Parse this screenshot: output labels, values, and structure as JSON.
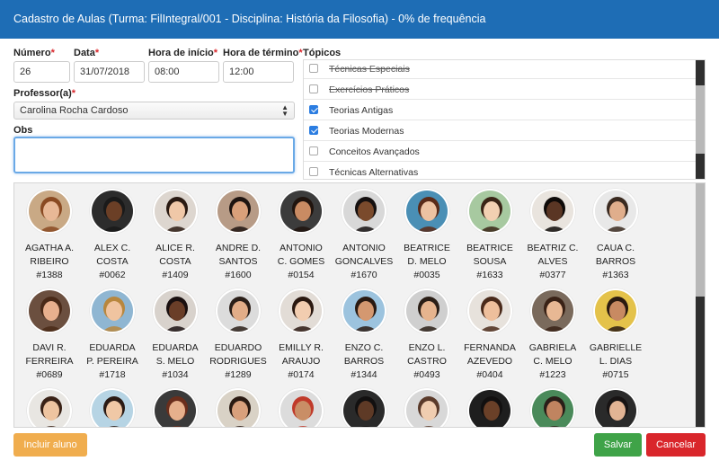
{
  "header": {
    "title": "Cadastro de Aulas (Turma: FilIntegral/001 - Disciplina: História da Filosofia) - 0% de frequência"
  },
  "form": {
    "numero": {
      "label": "Número",
      "value": "26"
    },
    "data": {
      "label": "Data",
      "value": "31/07/2018"
    },
    "hora_inicio": {
      "label": "Hora de início",
      "value": "08:00"
    },
    "hora_termino": {
      "label": "Hora de término",
      "value": "12:00"
    },
    "professor": {
      "label": "Professor(a)",
      "value": "Carolina Rocha Cardoso"
    },
    "obs": {
      "label": "Obs",
      "value": ""
    },
    "required_mark": "*"
  },
  "topics": {
    "label": "Tópicos",
    "items": [
      {
        "label": "Técnicas Especiais",
        "checked": false,
        "struck": true
      },
      {
        "label": "Exercícios Práticos",
        "checked": false,
        "struck": true
      },
      {
        "label": "Teorias Antigas",
        "checked": true,
        "struck": false
      },
      {
        "label": "Teorias Modernas",
        "checked": true,
        "struck": false
      },
      {
        "label": "Conceitos Avançados",
        "checked": false,
        "struck": false
      },
      {
        "label": "Técnicas Alternativas",
        "checked": false,
        "struck": false
      }
    ]
  },
  "students": [
    {
      "first": "AGATHA A.",
      "last": "RIBEIRO",
      "id": "#1388",
      "skin": "#e8b896",
      "hair": "#8a4a22",
      "bg": "#c9a985"
    },
    {
      "first": "ALEX C.",
      "last": "COSTA",
      "id": "#0062",
      "skin": "#6b3f26",
      "hair": "#1a1a1a",
      "bg": "#2c2c2c"
    },
    {
      "first": "ALICE R.",
      "last": "COSTA",
      "id": "#1409",
      "skin": "#f0c8a8",
      "hair": "#2a1a12",
      "bg": "#ddd6cf"
    },
    {
      "first": "ANDRE D.",
      "last": "SANTOS",
      "id": "#1600",
      "skin": "#d9a07a",
      "hair": "#1e1410",
      "bg": "#b79b86"
    },
    {
      "first": "ANTONIO",
      "last": "C. GOMES",
      "id": "#0154",
      "skin": "#c98b63",
      "hair": "#20140e",
      "bg": "#3c3c3c"
    },
    {
      "first": "ANTONIO",
      "last": "GONCALVES",
      "id": "#1670",
      "skin": "#7a4a2c",
      "hair": "#151010",
      "bg": "#d8d8d8"
    },
    {
      "first": "BEATRICE",
      "last": "D. MELO",
      "id": "#0035",
      "skin": "#edc2a2",
      "hair": "#5a2a18",
      "bg": "#4a8fb5"
    },
    {
      "first": "BEATRICE",
      "last": "SOUSA",
      "id": "#1633",
      "skin": "#f2d0b2",
      "hair": "#3a2416",
      "bg": "#a7c9a0"
    },
    {
      "first": "BEATRIZ C.",
      "last": "ALVES",
      "id": "#0377",
      "skin": "#5a3624",
      "hair": "#0e0a08",
      "bg": "#e9e4de"
    },
    {
      "first": "CAUA C.",
      "last": "BARROS",
      "id": "#1363",
      "skin": "#e0ae8c",
      "hair": "#3a2a20",
      "bg": "#e8e8e8"
    },
    {
      "first": "DAVI R.",
      "last": "FERREIRA",
      "id": "#0689",
      "skin": "#e8b08e",
      "hair": "#4a2a18",
      "bg": "#6b4f3f"
    },
    {
      "first": "EDUARDA",
      "last": "P. PEREIRA",
      "id": "#1718",
      "skin": "#f0c4a0",
      "hair": "#b8873e",
      "bg": "#8fb6d2"
    },
    {
      "first": "EDUARDA",
      "last": "S. MELO",
      "id": "#1034",
      "skin": "#6a3e28",
      "hair": "#1a1010",
      "bg": "#d8d2cc"
    },
    {
      "first": "EDUARDO",
      "last": "RODRIGUES",
      "id": "#1289",
      "skin": "#e2ad88",
      "hair": "#2a1e18",
      "bg": "#dcdcdc"
    },
    {
      "first": "EMILLY R.",
      "last": "ARAUJO",
      "id": "#0174",
      "skin": "#f2cdb0",
      "hair": "#2a1810",
      "bg": "#e2dcd6"
    },
    {
      "first": "ENZO C.",
      "last": "BARROS",
      "id": "#1344",
      "skin": "#d49870",
      "hair": "#2a1a12",
      "bg": "#9cc3de"
    },
    {
      "first": "ENZO L.",
      "last": "CASTRO",
      "id": "#0493",
      "skin": "#e6b48e",
      "hair": "#2a1e16",
      "bg": "#cfcfcf"
    },
    {
      "first": "FERNANDA",
      "last": "AZEVEDO",
      "id": "#0404",
      "skin": "#eebf9c",
      "hair": "#4a2a1a",
      "bg": "#e7e2dc"
    },
    {
      "first": "GABRIELA",
      "last": "C. MELO",
      "id": "#1223",
      "skin": "#e8b894",
      "hair": "#3a2216",
      "bg": "#7a6a5c"
    },
    {
      "first": "GABRIELLE",
      "last": "L. DIAS",
      "id": "#0715",
      "skin": "#c88a62",
      "hair": "#2a1a10",
      "bg": "#e4c24a"
    },
    {
      "first": "",
      "last": "",
      "id": "",
      "skin": "#eec4a0",
      "hair": "#3a2216",
      "bg": "#e8e6e2"
    },
    {
      "first": "",
      "last": "",
      "id": "",
      "skin": "#f0c8a6",
      "hair": "#2a1a14",
      "bg": "#b6d4e4"
    },
    {
      "first": "",
      "last": "",
      "id": "",
      "skin": "#e6b08c",
      "hair": "#6a2e1c",
      "bg": "#3a3a3a"
    },
    {
      "first": "",
      "last": "",
      "id": "",
      "skin": "#d8a07c",
      "hair": "#2a1a12",
      "bg": "#d9d2c6"
    },
    {
      "first": "",
      "last": "",
      "id": "",
      "skin": "#c98e66",
      "hair": "#c03a2a",
      "bg": "#dcdcdc"
    },
    {
      "first": "",
      "last": "",
      "id": "",
      "skin": "#5e3a26",
      "hair": "#121010",
      "bg": "#2a2a2a"
    },
    {
      "first": "",
      "last": "",
      "id": "",
      "skin": "#f0cdb0",
      "hair": "#5a3a2a",
      "bg": "#d8d8d8"
    },
    {
      "first": "",
      "last": "",
      "id": "",
      "skin": "#6a4028",
      "hair": "#121010",
      "bg": "#1e1e1e"
    },
    {
      "first": "",
      "last": "",
      "id": "",
      "skin": "#c08460",
      "hair": "#2a1e18",
      "bg": "#4a8a5a"
    },
    {
      "first": "",
      "last": "",
      "id": "",
      "skin": "#e2b494",
      "hair": "#181414",
      "bg": "#2a2a2a"
    }
  ],
  "buttons": {
    "add": "Incluir aluno",
    "save": "Salvar",
    "cancel": "Cancelar"
  },
  "colors": {
    "header": "#1e6db5",
    "add": "#f0ad4e",
    "save": "#3fa348",
    "cancel": "#d9262b",
    "required": "#d9262b",
    "check": "#2b7de1"
  }
}
